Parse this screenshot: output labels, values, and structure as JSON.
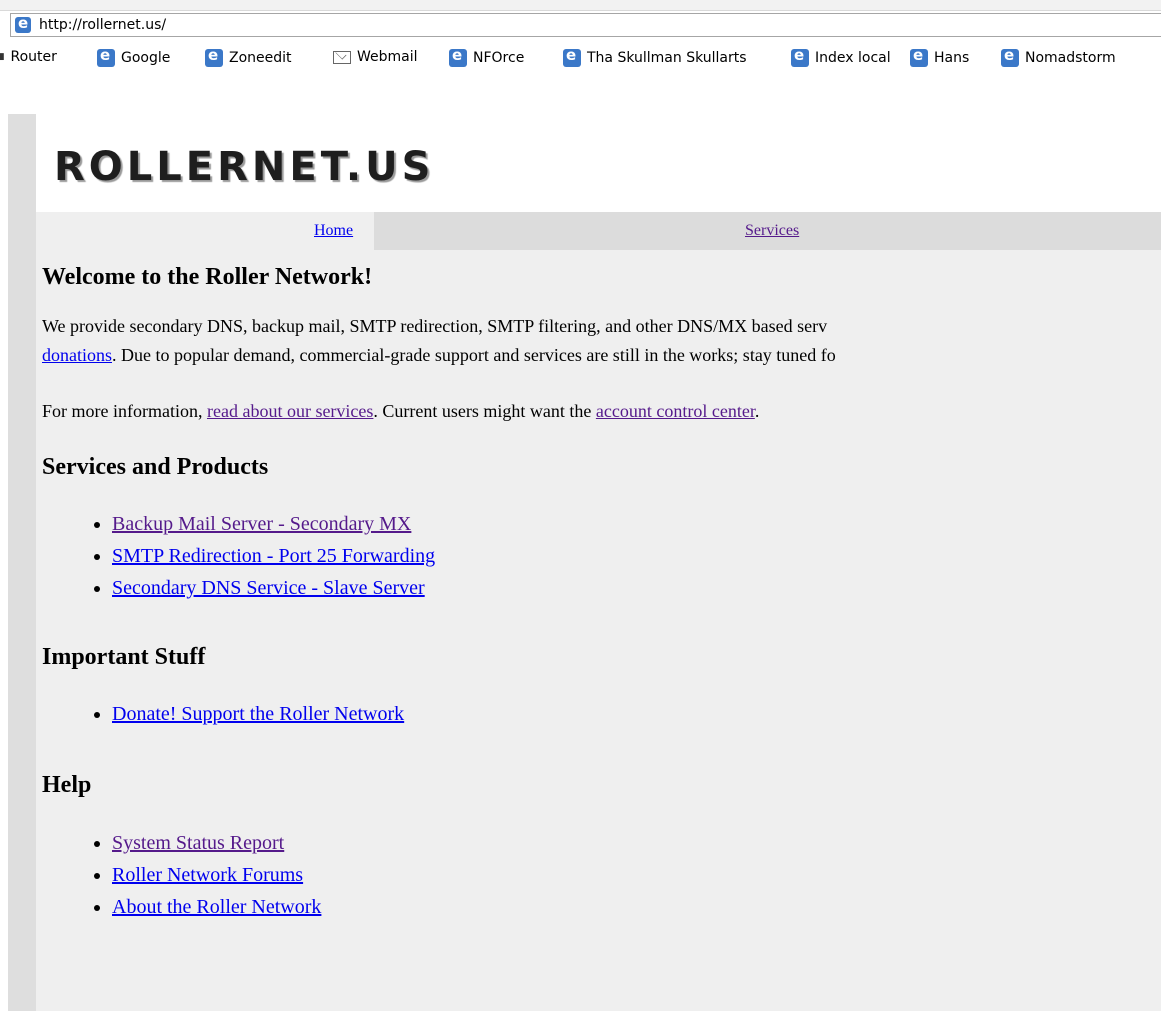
{
  "browser": {
    "url": "http://rollernet.us/",
    "links_bar": [
      "Router",
      "Google",
      "Zoneedit",
      "Webmail",
      "NFOrce",
      "Tha Skullman Skullarts",
      "Index local",
      "Hans",
      "Nomadstorm"
    ]
  },
  "site": {
    "logo": "ROLLERNET.US",
    "nav": {
      "home": "Home",
      "services": "Services"
    }
  },
  "welcome": {
    "heading": "Welcome to the Roller Network!",
    "p1_line1": "We provide secondary DNS, backup mail, SMTP redirection, SMTP filtering, and other DNS/MX based serv",
    "p1_link": "donations",
    "p1_line2_rest": ". Due to popular demand, commercial-grade support and services are still in the works; stay tuned fo",
    "p2_start": "For more information, ",
    "p2_link1": "read about our services",
    "p2_mid": ". Current users might want the ",
    "p2_link2": "account control center",
    "p2_end": "."
  },
  "services_section": {
    "heading": "Services and Products",
    "items": [
      "Backup Mail Server - Secondary MX",
      "SMTP Redirection - Port 25 Forwarding",
      "Secondary DNS Service - Slave Server"
    ]
  },
  "important_section": {
    "heading": "Important Stuff",
    "items": [
      "Donate! Support the Roller Network"
    ]
  },
  "help_section": {
    "heading": "Help",
    "items": [
      "System Status Report",
      "Roller Network Forums",
      "About the Roller Network"
    ]
  }
}
